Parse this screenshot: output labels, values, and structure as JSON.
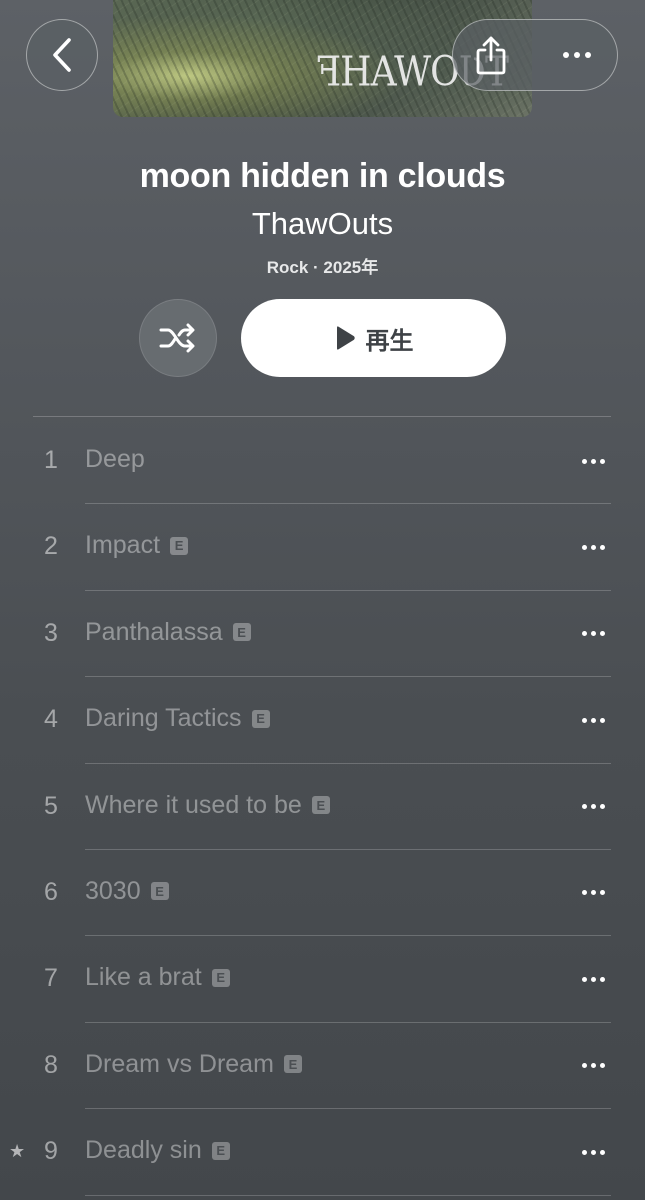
{
  "artwork": {
    "logo_text": "THAWOUTS",
    "logo_display": "ꟻHAWOƲT"
  },
  "header": {
    "back_icon": "chevron-left-icon",
    "share_icon": "share-icon",
    "more_icon": "ellipsis-icon"
  },
  "album": {
    "title": "moon hidden in clouds",
    "artist": "ThawOuts",
    "meta": "Rock · 2025年"
  },
  "controls": {
    "shuffle_icon": "shuffle-icon",
    "play_icon": "play-icon",
    "play_label": "再生"
  },
  "tracks": [
    {
      "number": "1",
      "title": "Deep",
      "explicit": false,
      "starred": false
    },
    {
      "number": "2",
      "title": "Impact",
      "explicit": true,
      "starred": false
    },
    {
      "number": "3",
      "title": "Panthalassa",
      "explicit": true,
      "starred": false
    },
    {
      "number": "4",
      "title": "Daring Tactics",
      "explicit": true,
      "starred": false
    },
    {
      "number": "5",
      "title": "Where it used to be",
      "explicit": true,
      "starred": false
    },
    {
      "number": "6",
      "title": "3030",
      "explicit": true,
      "starred": false
    },
    {
      "number": "7",
      "title": "Like a brat",
      "explicit": true,
      "starred": false
    },
    {
      "number": "8",
      "title": "Dream vs Dream",
      "explicit": true,
      "starred": false
    },
    {
      "number": "9",
      "title": "Deadly sin",
      "explicit": true,
      "starred": true
    }
  ],
  "explicit_badge": "E",
  "star_glyph": "★",
  "colors": {
    "background_top": "#5d6166",
    "background_bottom": "#43474b",
    "play_button_bg": "#ffffff",
    "play_button_text": "#3e4246"
  }
}
